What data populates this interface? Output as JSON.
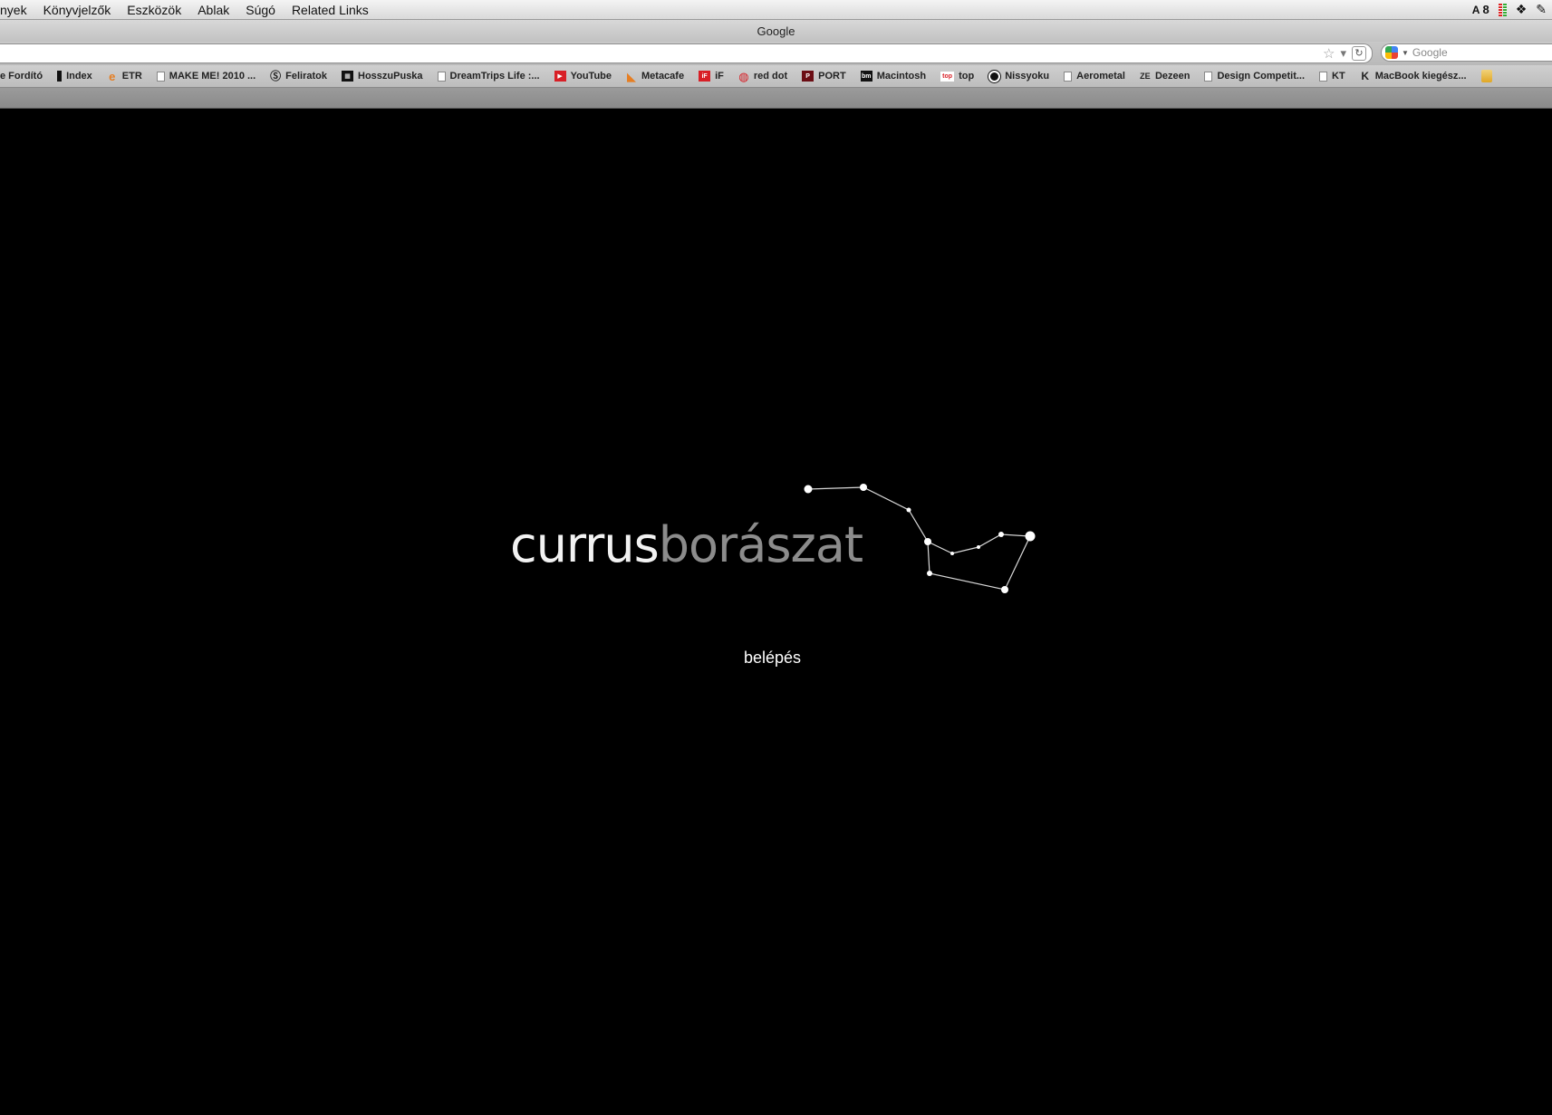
{
  "menubar": {
    "items": [
      "nyek",
      "Könyvjelzők",
      "Eszközök",
      "Ablak",
      "Súgó",
      "Related Links"
    ],
    "adobe_count": "8"
  },
  "window": {
    "title": "Google"
  },
  "search": {
    "placeholder": "Google"
  },
  "bookmarks": [
    {
      "label": "e Fordító",
      "icon": "none"
    },
    {
      "label": "Index",
      "icon": "index-icon"
    },
    {
      "label": "ETR",
      "icon": "etr-icon"
    },
    {
      "label": "MAKE ME! 2010 ...",
      "icon": "page-icon"
    },
    {
      "label": "Feliratok",
      "icon": "feliratok-icon"
    },
    {
      "label": "HosszuPuska",
      "icon": "hosszupuska-icon"
    },
    {
      "label": "DreamTrips Life :...",
      "icon": "page-icon"
    },
    {
      "label": "YouTube",
      "icon": "youtube-icon"
    },
    {
      "label": "Metacafe",
      "icon": "metacafe-icon"
    },
    {
      "label": "iF",
      "icon": "if-icon"
    },
    {
      "label": "red dot",
      "icon": "red-dot-icon"
    },
    {
      "label": "PORT",
      "icon": "port-icon"
    },
    {
      "label": "Macintosh",
      "icon": "bm-icon"
    },
    {
      "label": "top",
      "icon": "top-icon"
    },
    {
      "label": "Nissyoku",
      "icon": "nissyoku-icon"
    },
    {
      "label": "Aerometal",
      "icon": "page-icon"
    },
    {
      "label": "Dezeen",
      "icon": "dezeen-icon"
    },
    {
      "label": "Design Competit...",
      "icon": "page-icon"
    },
    {
      "label": "KT",
      "icon": "page-icon"
    },
    {
      "label": "MacBook kiegész...",
      "icon": "macbook-icon"
    }
  ],
  "site": {
    "logo_part1": "currus",
    "logo_part2": "borászat",
    "enter_label": "belépés"
  },
  "colors": {
    "background": "#000000",
    "logo_primary": "#f2f2f2",
    "logo_secondary": "#8c8c8c"
  }
}
